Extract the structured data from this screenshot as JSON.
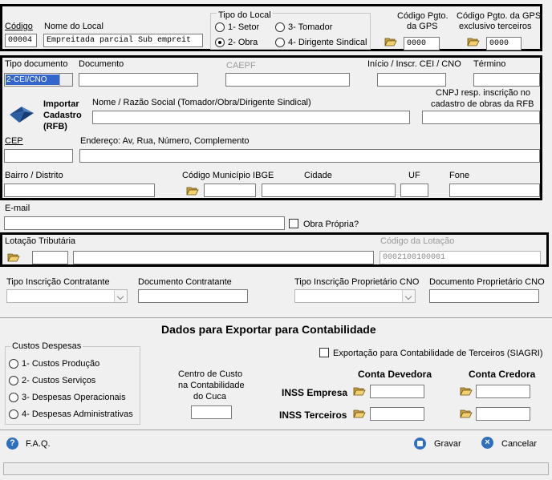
{
  "header": {
    "codigo_label": "Código",
    "codigo_value": "00004",
    "nome_label": "Nome do Local",
    "nome_value": "Empreitada parcial Sub empreit",
    "tipo_local_label": "Tipo do Local",
    "tipo_options": [
      "1- Setor",
      "3- Tomador",
      "2- Obra",
      "4- Dirigente Sindical"
    ],
    "codigo_gps_label_1": "Código Pgto.",
    "codigo_gps_label_2": "da GPS",
    "codigo_gps_value": "0000",
    "codigo_gps_terc_label_1": "Código Pgto. da GPS",
    "codigo_gps_terc_label_2": "exclusivo terceiros",
    "codigo_gps_terc_value": "0000"
  },
  "doc": {
    "tipo_documento_label": "Tipo documento",
    "tipo_documento_value": "2-CEI/CNO",
    "documento_label": "Documento",
    "caepf_label": "CAEPF",
    "inicio_label": "Início / Inscr. CEI / CNO",
    "termino_label": "Término",
    "importar_1": "Importar",
    "importar_2": "Cadastro",
    "importar_3": "(RFB)",
    "nome_razao_label": "Nome / Razão Social (Tomador/Obra/Dirigente Sindical)",
    "cnpj_resp_label_1": "CNPJ resp. inscrição no",
    "cnpj_resp_label_2": "cadastro de obras da RFB",
    "cep_label": "CEP",
    "endereco_label": "Endereço: Av, Rua, Número, Complemento",
    "bairro_label": "Bairro / Distrito",
    "cod_municipio_label": "Código Município IBGE",
    "cidade_label": "Cidade",
    "uf_label": "UF",
    "fone_label": "Fone"
  },
  "email": {
    "label": "E-mail",
    "obra_propria_label": "Obra Própria?"
  },
  "lotacao": {
    "label": "Lotação Tributária",
    "codigo_label": "Código da Lotação",
    "codigo_value": "0002100100001"
  },
  "contratante": {
    "tipo_inscricao_label": "Tipo Inscrição Contratante",
    "documento_label": "Documento Contratante",
    "tipo_proprietario_label": "Tipo Inscrição Proprietário CNO",
    "documento_proprietario_label": "Documento Proprietário CNO"
  },
  "contabilidade": {
    "title": "Dados para Exportar para Contabilidade",
    "custos_label": "Custos Despesas",
    "custos_options": [
      "1- Custos Produção",
      "2- Custos Serviços",
      "3- Despesas Operacionais",
      "4- Despesas Administrativas"
    ],
    "siagri_label": "Exportação para Contabilidade de Terceiros (SIAGRI)",
    "centro_custo_1": "Centro de Custo",
    "centro_custo_2": "na Contabilidade",
    "centro_custo_3": "do Cuca",
    "conta_devedora": "Conta Devedora",
    "conta_credora": "Conta Credora",
    "inss_empresa": "INSS Empresa",
    "inss_terceiros": "INSS Terceiros"
  },
  "footer": {
    "faq_label": "F.A.Q.",
    "gravar_label": "Gravar",
    "cancelar_label": "Cancelar"
  }
}
